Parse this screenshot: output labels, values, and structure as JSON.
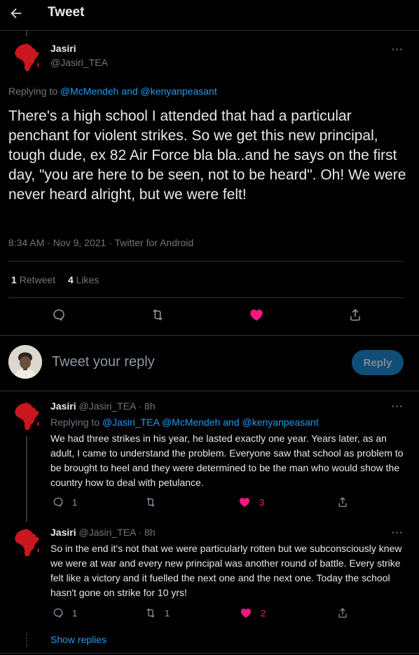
{
  "header": {
    "title": "Tweet"
  },
  "main_tweet": {
    "author_name": "Jasiri",
    "author_handle": "@Jasiri_TEA",
    "replying_prefix": "Replying to ",
    "replying_to": "@McMendeh and @kenyanpeasant",
    "text": "There's a high school I attended that had a particular penchant for violent strikes. So we get this new principal, tough dude, ex 82 Air Force bla bla..and he says on the first day, \"you are here to be seen, not to be heard\". Oh! We were never heard alright, but we were felt!",
    "timestamp": "8:34 AM · Nov 9, 2021 · Twitter for Android",
    "retweets_count": "1",
    "retweets_label": "Retweet",
    "likes_count": "4",
    "likes_label": "Likes"
  },
  "composer": {
    "placeholder": "Tweet your reply",
    "reply_button": "Reply"
  },
  "replies": [
    {
      "author_name": "Jasiri",
      "author_meta": "@Jasiri_TEA · 8h",
      "replying_prefix": "Replying to ",
      "replying_to": "@Jasiri_TEA @McMendeh and @kenyanpeasant",
      "text": "We had three strikes in his year, he lasted exactly one year. Years later, as an adult, I came to understand the problem. Everyone saw that school as problem to be brought to heel and they were determined to be the man who would show the country how to deal with petulance.",
      "reply_count": "1",
      "retweet_count": "",
      "like_count": "3"
    },
    {
      "author_name": "Jasiri",
      "author_meta": "@Jasiri_TEA · 8h",
      "text": "So in the end it's not that we were particularly rotten but we subconsciously knew we were at war and every new principal was another round of battle. Every strike felt like a victory and it fuelled the next one and the next one. Today the school hasn't gone on strike for 10 yrs!",
      "reply_count": "1",
      "retweet_count": "1",
      "like_count": "2"
    }
  ],
  "show_replies": "Show replies",
  "more_icon_glyph": "···",
  "colors": {
    "background": "#000000",
    "accent": "#1d9bf0",
    "like": "#f91880",
    "muted": "#6e767d",
    "divider": "#2f3336",
    "avatar_red": "#c8171e"
  }
}
